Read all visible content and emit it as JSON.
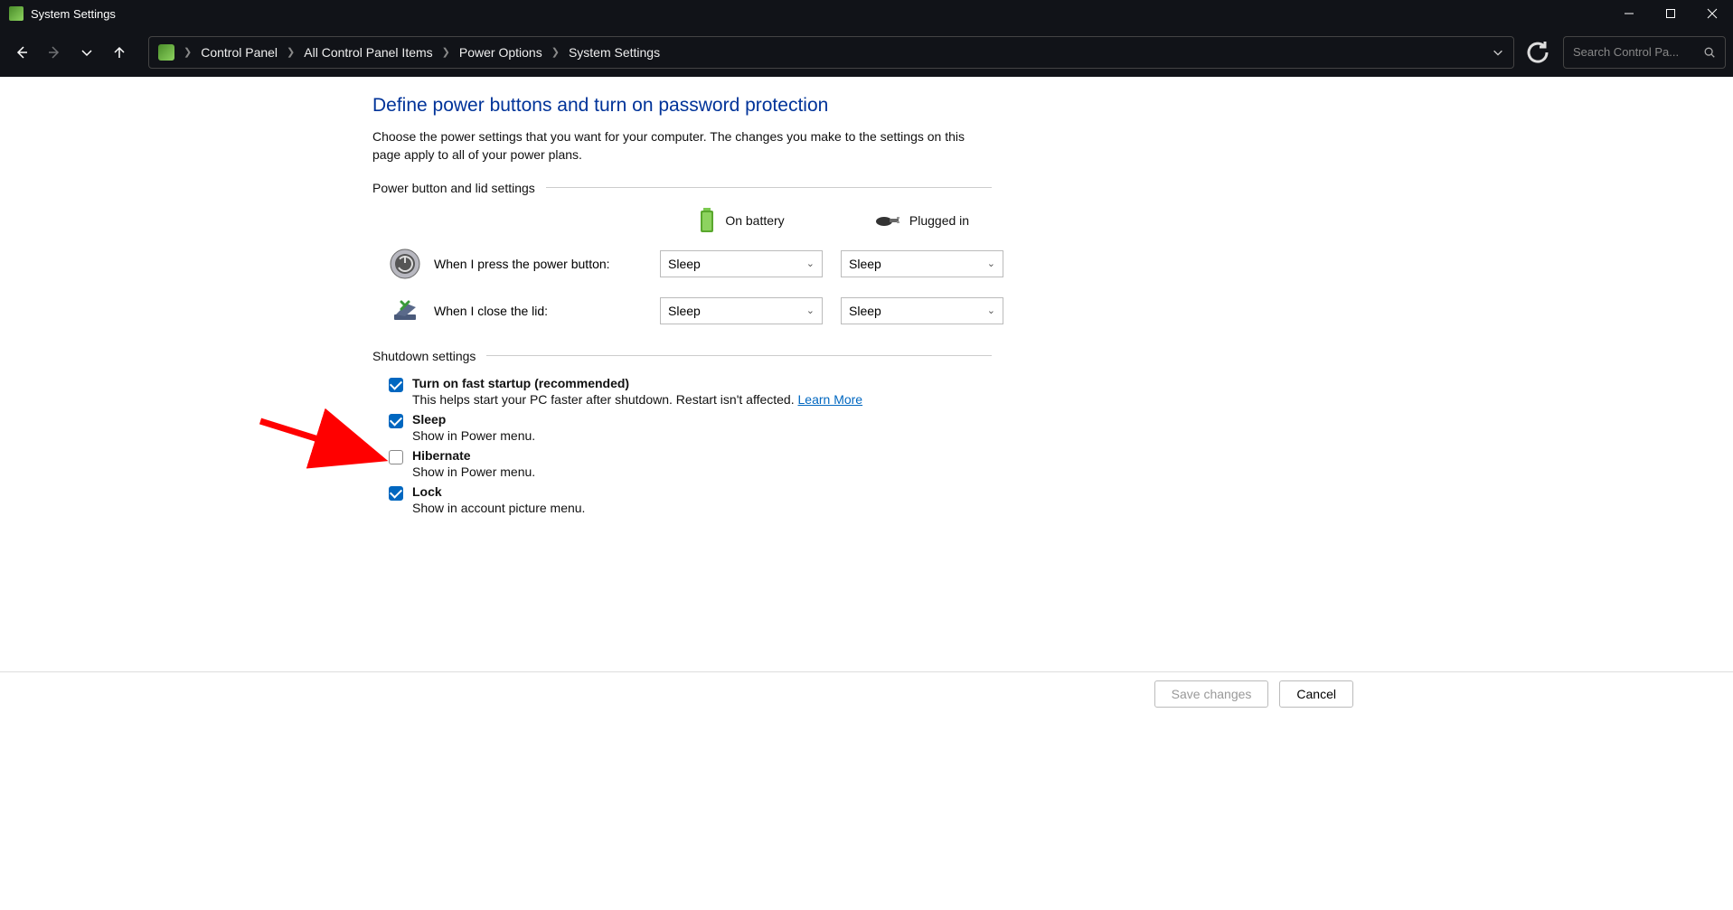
{
  "window": {
    "title": "System Settings"
  },
  "breadcrumbs": {
    "item0": "Control Panel",
    "item1": "All Control Panel Items",
    "item2": "Power Options",
    "item3": "System Settings"
  },
  "search": {
    "placeholder": "Search Control Pa..."
  },
  "page": {
    "heading": "Define power buttons and turn on password protection",
    "description": "Choose the power settings that you want for your computer. The changes you make to the settings on this page apply to all of your power plans."
  },
  "sections": {
    "power_button": "Power button and lid settings",
    "shutdown": "Shutdown settings"
  },
  "columns": {
    "battery": "On battery",
    "plugged": "Plugged in"
  },
  "rows": {
    "press_power": "When I press the power button:",
    "close_lid": "When I close the lid:"
  },
  "selects": {
    "press_power_battery": "Sleep",
    "press_power_plugged": "Sleep",
    "close_lid_battery": "Sleep",
    "close_lid_plugged": "Sleep"
  },
  "shutdown": {
    "fast_startup": {
      "title": "Turn on fast startup (recommended)",
      "desc": "This helps start your PC faster after shutdown. Restart isn't affected. ",
      "link": "Learn More",
      "checked": true
    },
    "sleep": {
      "title": "Sleep",
      "desc": "Show in Power menu.",
      "checked": true
    },
    "hibernate": {
      "title": "Hibernate",
      "desc": "Show in Power menu.",
      "checked": false
    },
    "lock": {
      "title": "Lock",
      "desc": "Show in account picture menu.",
      "checked": true
    }
  },
  "footer": {
    "save": "Save changes",
    "cancel": "Cancel"
  }
}
